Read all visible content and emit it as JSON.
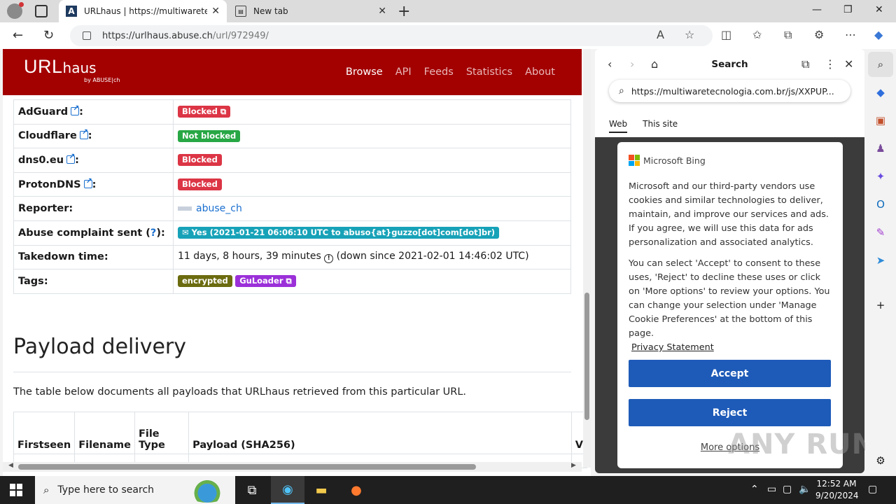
{
  "browser": {
    "tabs": [
      {
        "title": "URLhaus | https://multiwaretecnologi",
        "icon": "urlhaus-favicon"
      },
      {
        "title": "New tab",
        "icon": "newtab-favicon"
      }
    ],
    "address": {
      "host": "https://urlhaus.abuse.ch",
      "path": "/url/972949/"
    }
  },
  "site": {
    "logo_main": "URL",
    "logo_sub": "haus",
    "logo_by": "by ABUSE|ch",
    "nav": [
      "Browse",
      "API",
      "Feeds",
      "Statistics",
      "About"
    ]
  },
  "info_rows": [
    {
      "key": "AdGuard",
      "status": "Blocked",
      "color": "#dc3545"
    },
    {
      "key": "Cloudflare",
      "status": "Not blocked",
      "color": "#28a745"
    },
    {
      "key": "dns0.eu",
      "status": "Blocked",
      "color": "#dc3545"
    },
    {
      "key": "ProtonDNS",
      "status": "Blocked",
      "color": "#dc3545"
    }
  ],
  "reporter": {
    "label": "Reporter:",
    "value": "abuse_ch"
  },
  "abuse": {
    "label_prefix": "Abuse complaint sent (",
    "label_q": "?",
    "label_suffix": "):",
    "value": "Yes (2021-01-21 06:06:10 UTC to abuso{at}guzzo[dot]com[dot]br)"
  },
  "takedown": {
    "label": "Takedown time:",
    "value_a": "11 days, 8 hours, 39 minutes",
    "value_b": "(down since 2021-02-01 14:46:02 UTC)"
  },
  "tags": {
    "label": "Tags:",
    "items": [
      "encrypted",
      "GuLoader"
    ]
  },
  "payload": {
    "heading": "Payload delivery",
    "description": "The table below documents all payloads that URLhaus retrieved from this particular URL.",
    "columns": [
      "Firstseen",
      "Filename",
      "File Type",
      "Payload (SHA256)",
      "V"
    ]
  },
  "side_panel": {
    "title": "Search",
    "query": "https://multiwaretecnologia.com.br/js/XXPUP...",
    "tabs": [
      "Web",
      "This site"
    ],
    "consent": {
      "brand": "Microsoft Bing",
      "p1": "Microsoft and our third-party vendors use cookies and similar technologies to deliver, maintain, and improve our services and ads. If you agree, we will use this data for ads personalization and associated analytics.",
      "p2": "You can select 'Accept' to consent to these uses, 'Reject' to decline these uses or click on 'More options' to review your options. You can change your selection under 'Manage Cookie Preferences' at the bottom of this page.",
      "privacy": "Privacy Statement",
      "accept": "Accept",
      "reject": "Reject",
      "more": "More options"
    }
  },
  "taskbar": {
    "search_placeholder": "Type here to search",
    "time": "12:52 AM",
    "date": "9/20/2024"
  },
  "watermark": "ANY RUN"
}
